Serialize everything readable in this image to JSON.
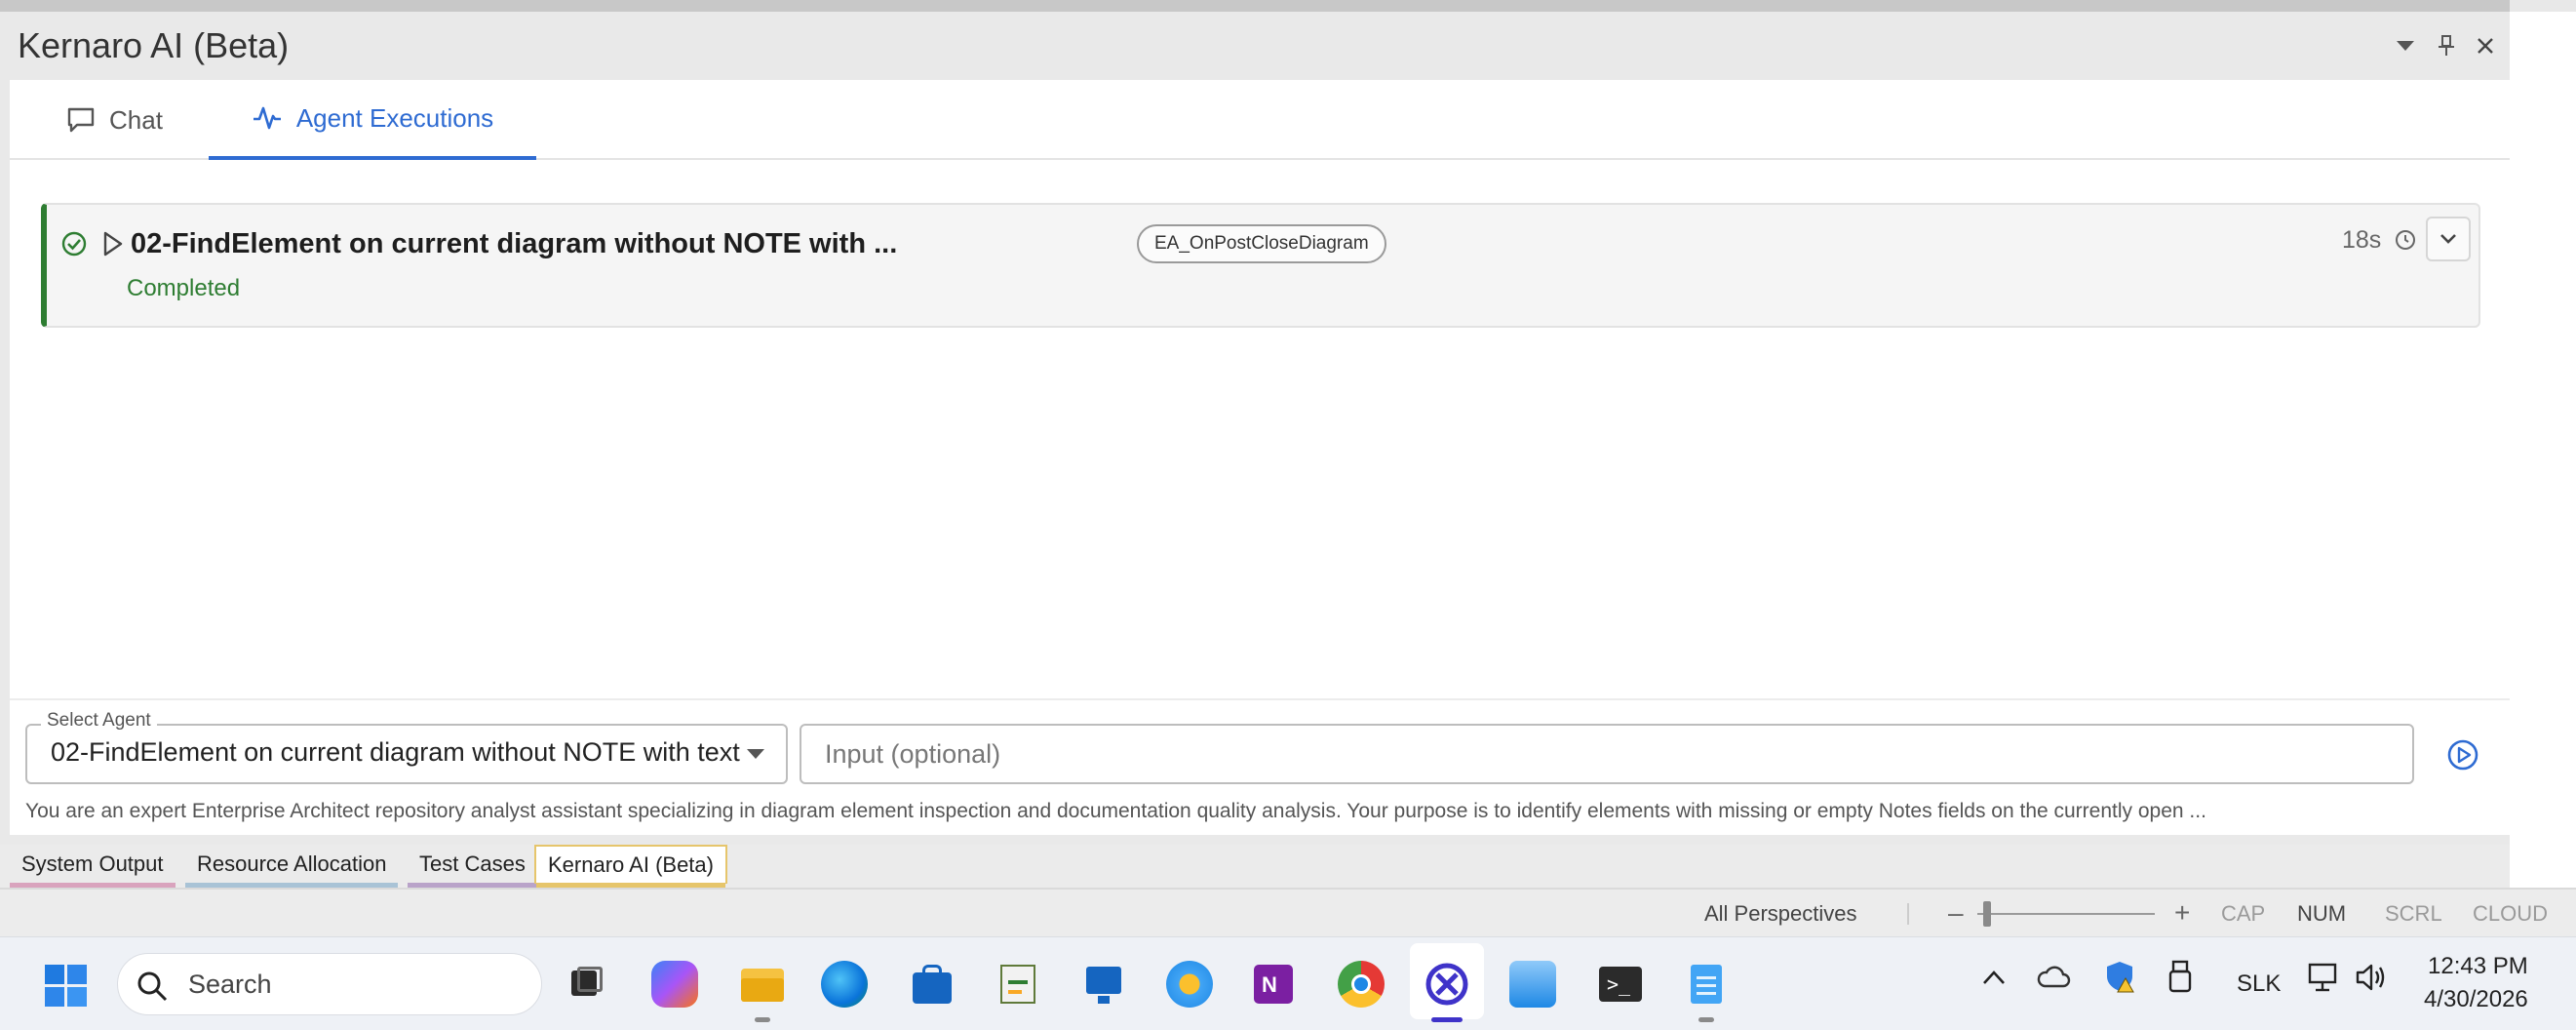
{
  "panel": {
    "title": "Kernaro AI (Beta)",
    "controls": {
      "dropdown": "▾",
      "pin": "⊥",
      "close": "✕"
    }
  },
  "tabs": [
    {
      "label": "Chat",
      "icon": "chat-bubble-icon",
      "active": false
    },
    {
      "label": "Agent Executions",
      "icon": "activity-pulse-icon",
      "active": true
    }
  ],
  "execution": {
    "title": "02-FindElement on current diagram without NOTE with ...",
    "status": "Completed",
    "tag": "EA_OnPostCloseDiagram",
    "duration": "18s",
    "status_color": "#2e7d32"
  },
  "input": {
    "agent_label": "Select Agent",
    "agent_value": "02-FindElement on current diagram without NOTE with text",
    "placeholder": "Input (optional)",
    "system_prompt": "You are an expert Enterprise Architect repository analyst assistant specializing in diagram element inspection and documentation quality analysis. Your purpose is to identify elements with missing or empty Notes fields on the currently open ..."
  },
  "bottom_tabs": [
    {
      "label": "System Output",
      "color": "#d9a3bd"
    },
    {
      "label": "Resource Allocation",
      "color": "#a9c3d6"
    },
    {
      "label": "Test Cases",
      "color": "#b9a3c9"
    },
    {
      "label": "Kernaro AI (Beta)",
      "color": "#e6c56b",
      "active": true
    }
  ],
  "statusbar": {
    "perspective": "All Perspectives",
    "zoom_minus": "–",
    "zoom_plus": "+",
    "indicators": [
      {
        "label": "CAP",
        "active": false
      },
      {
        "label": "NUM",
        "active": true
      },
      {
        "label": "SCRL",
        "active": false
      },
      {
        "label": "CLOUD",
        "active": false
      }
    ]
  },
  "taskbar": {
    "search_label": "Search",
    "apps": [
      "task-view-icon",
      "copilot-icon",
      "file-explorer-icon",
      "edge-icon",
      "store-icon",
      "project-icon",
      "remote-desktop-icon",
      "settings-app-icon",
      "onenote-icon",
      "chrome-icon",
      "kernaro-app-icon",
      "photos-icon",
      "terminal-icon",
      "notepad-icon"
    ],
    "tray": {
      "keyboard": "SLK",
      "time": "12:43 PM",
      "date": "4/30/2026"
    }
  }
}
